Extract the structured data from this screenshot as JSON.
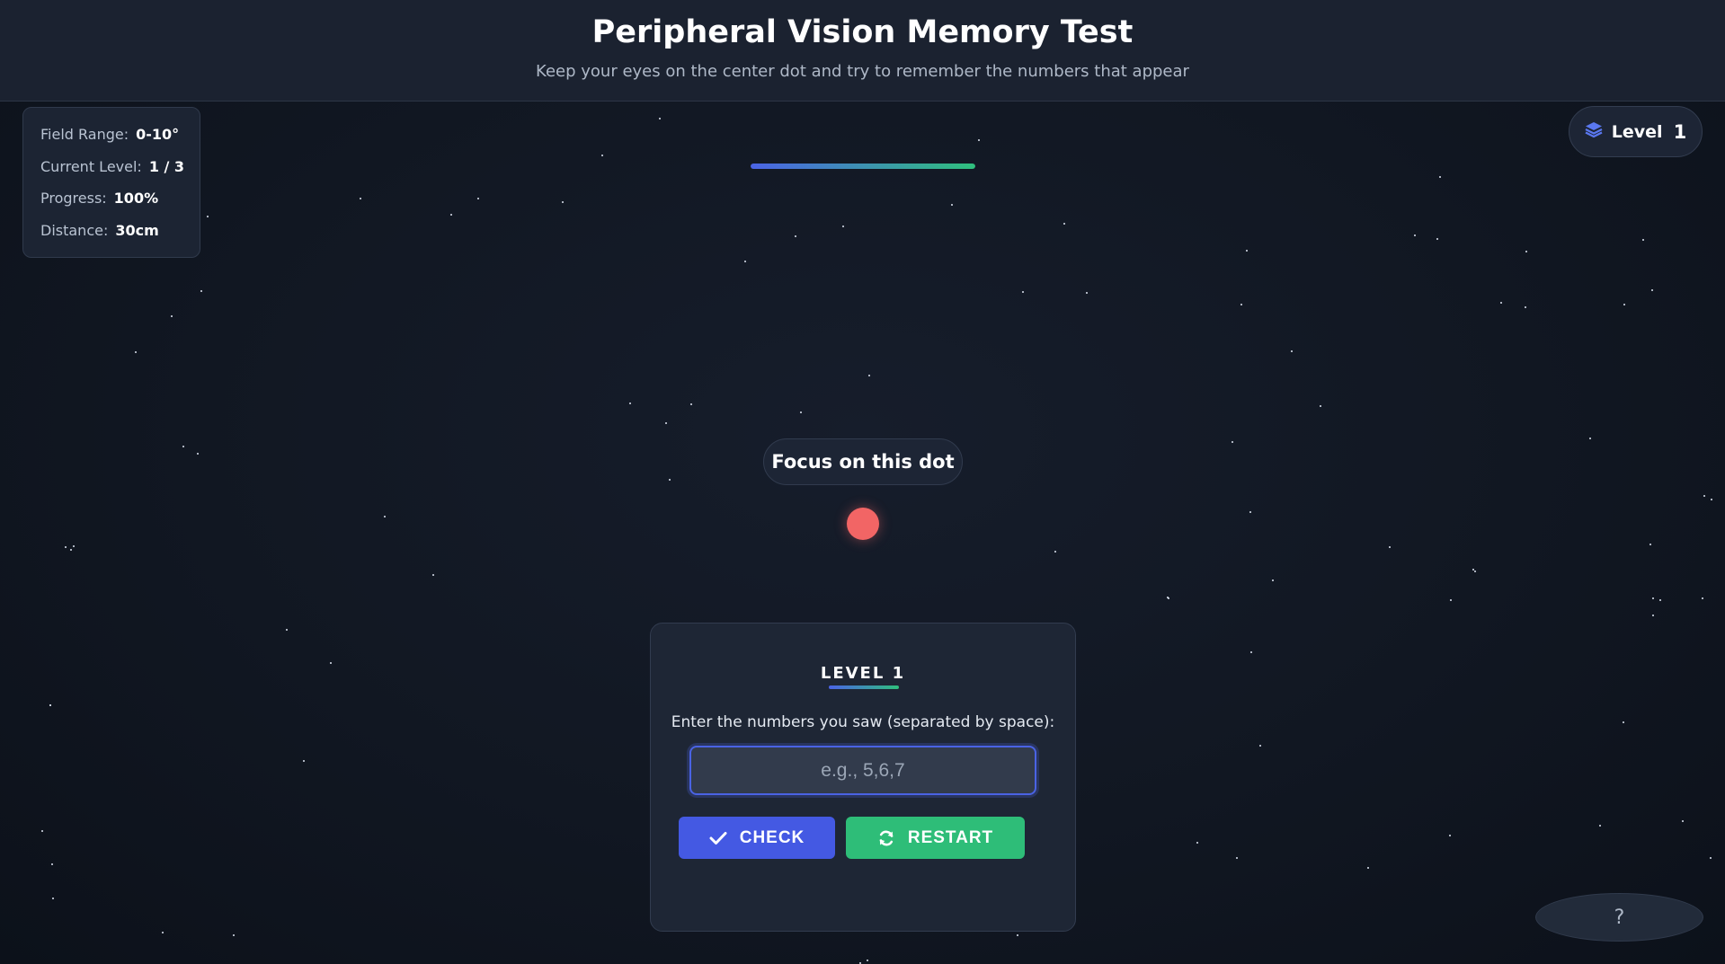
{
  "header": {
    "title": "Peripheral Vision Memory Test",
    "subtitle": "Keep your eyes on the center dot and try to remember the numbers that appear"
  },
  "stats": {
    "field_range_label": "Field Range:",
    "field_range_value": "0-10°",
    "current_level_label": "Current Level:",
    "current_level_value": "1 / 3",
    "progress_label": "Progress:",
    "progress_value": "100%",
    "distance_label": "Distance:",
    "distance_value": "30cm"
  },
  "level_badge": {
    "label": "Level",
    "value": "1",
    "icon": "layers-icon"
  },
  "progress_bar": {
    "fraction": 1.0
  },
  "focus": {
    "label": "Focus on this dot",
    "dot_color": "#f26565"
  },
  "panel": {
    "title": "LEVEL 1",
    "prompt": "Enter the numbers you saw (separated by space):",
    "input_value": "",
    "input_placeholder": "e.g., 5,6,7",
    "check_label": "CHECK",
    "restart_label": "RESTART"
  },
  "help": {
    "label": "?"
  },
  "colors": {
    "accent_blue": "#4459e3",
    "accent_green": "#2ebd78",
    "background": "#111722"
  }
}
